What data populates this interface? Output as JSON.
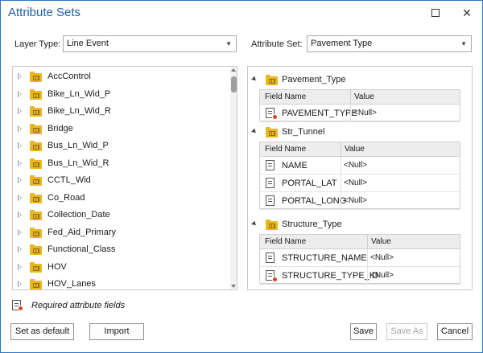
{
  "window": {
    "title": "Attribute Sets",
    "maximize_icon": "maximize-icon",
    "close_icon": "close-icon"
  },
  "layer_type": {
    "label": "Layer Type:",
    "value": "Line Event"
  },
  "attribute_set": {
    "label": "Attribute Set:",
    "value": "Pavement Type"
  },
  "tree": {
    "items": [
      {
        "label": "AccControl"
      },
      {
        "label": "Bike_Ln_Wid_P"
      },
      {
        "label": "Bike_Ln_Wid_R"
      },
      {
        "label": "Bridge"
      },
      {
        "label": "Bus_Ln_Wid_P"
      },
      {
        "label": "Bus_Ln_Wid_R"
      },
      {
        "label": "CCTL_Wid"
      },
      {
        "label": "Co_Road"
      },
      {
        "label": "Collection_Date"
      },
      {
        "label": "Fed_Aid_Primary"
      },
      {
        "label": "Functional_Class"
      },
      {
        "label": "HOV"
      },
      {
        "label": "HOV_Lanes"
      }
    ]
  },
  "groups": [
    {
      "name": "Pavement_Type",
      "headers": {
        "field": "Field Name",
        "value": "Value"
      },
      "rows": [
        {
          "field": "PAVEMENT_TYPE",
          "value": "<Null>",
          "required": true
        }
      ]
    },
    {
      "name": "Str_Tunnel",
      "headers": {
        "field": "Field Name",
        "value": "Value"
      },
      "rows": [
        {
          "field": "NAME",
          "value": "<Null>",
          "required": false
        },
        {
          "field": "PORTAL_LAT",
          "value": "<Null>",
          "required": false
        },
        {
          "field": "PORTAL_LONG",
          "value": "<Null>",
          "required": false
        }
      ]
    },
    {
      "name": "Structure_Type",
      "headers": {
        "field": "Field Name",
        "value": "Value"
      },
      "rows": [
        {
          "field": "STRUCTURE_NAME",
          "value": "<Null>",
          "required": false
        },
        {
          "field": "STRUCTURE_TYPE_ID",
          "value": "<Null>",
          "required": true
        }
      ]
    }
  ],
  "legend": {
    "text": "Required attribute fields"
  },
  "buttons": {
    "set_default": "Set as default",
    "import": "Import",
    "save": "Save",
    "save_as": "Save As",
    "cancel": "Cancel"
  }
}
